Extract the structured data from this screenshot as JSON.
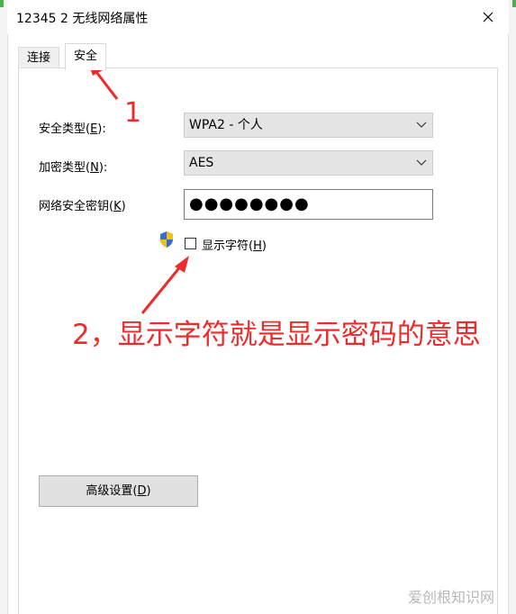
{
  "window": {
    "title": "12345 2 无线网络属性"
  },
  "tabs": [
    {
      "label": "连接"
    },
    {
      "label": "安全"
    }
  ],
  "security": {
    "type_label_prefix": "安全类型(",
    "type_label_key": "E",
    "type_label_suffix": "):",
    "type_value": "WPA2 - 个人",
    "encryption_label_prefix": "加密类型(",
    "encryption_label_key": "N",
    "encryption_label_suffix": "):",
    "encryption_value": "AES",
    "key_label_prefix": "网络安全密钥(",
    "key_label_key": "K",
    "key_label_suffix": ")",
    "key_value": "●●●●●●●●",
    "show_chars_prefix": "显示字符(",
    "show_chars_key": "H",
    "show_chars_suffix": ")",
    "show_chars_checked": false,
    "advanced_prefix": "高级设置(",
    "advanced_key": "D",
    "advanced_suffix": ")"
  },
  "annotations": {
    "note1": "1",
    "note2": "2，显示字符就是显示密码的意思"
  },
  "watermark": "爱创根知识网",
  "colors": {
    "annotation": "#ee2b2b",
    "select_bg": "#e5e5e5",
    "button_bg": "#e1e1e1"
  },
  "icons": {
    "close": "close-icon",
    "dropdown": "chevron-down-icon",
    "uac": "shield-icon"
  }
}
